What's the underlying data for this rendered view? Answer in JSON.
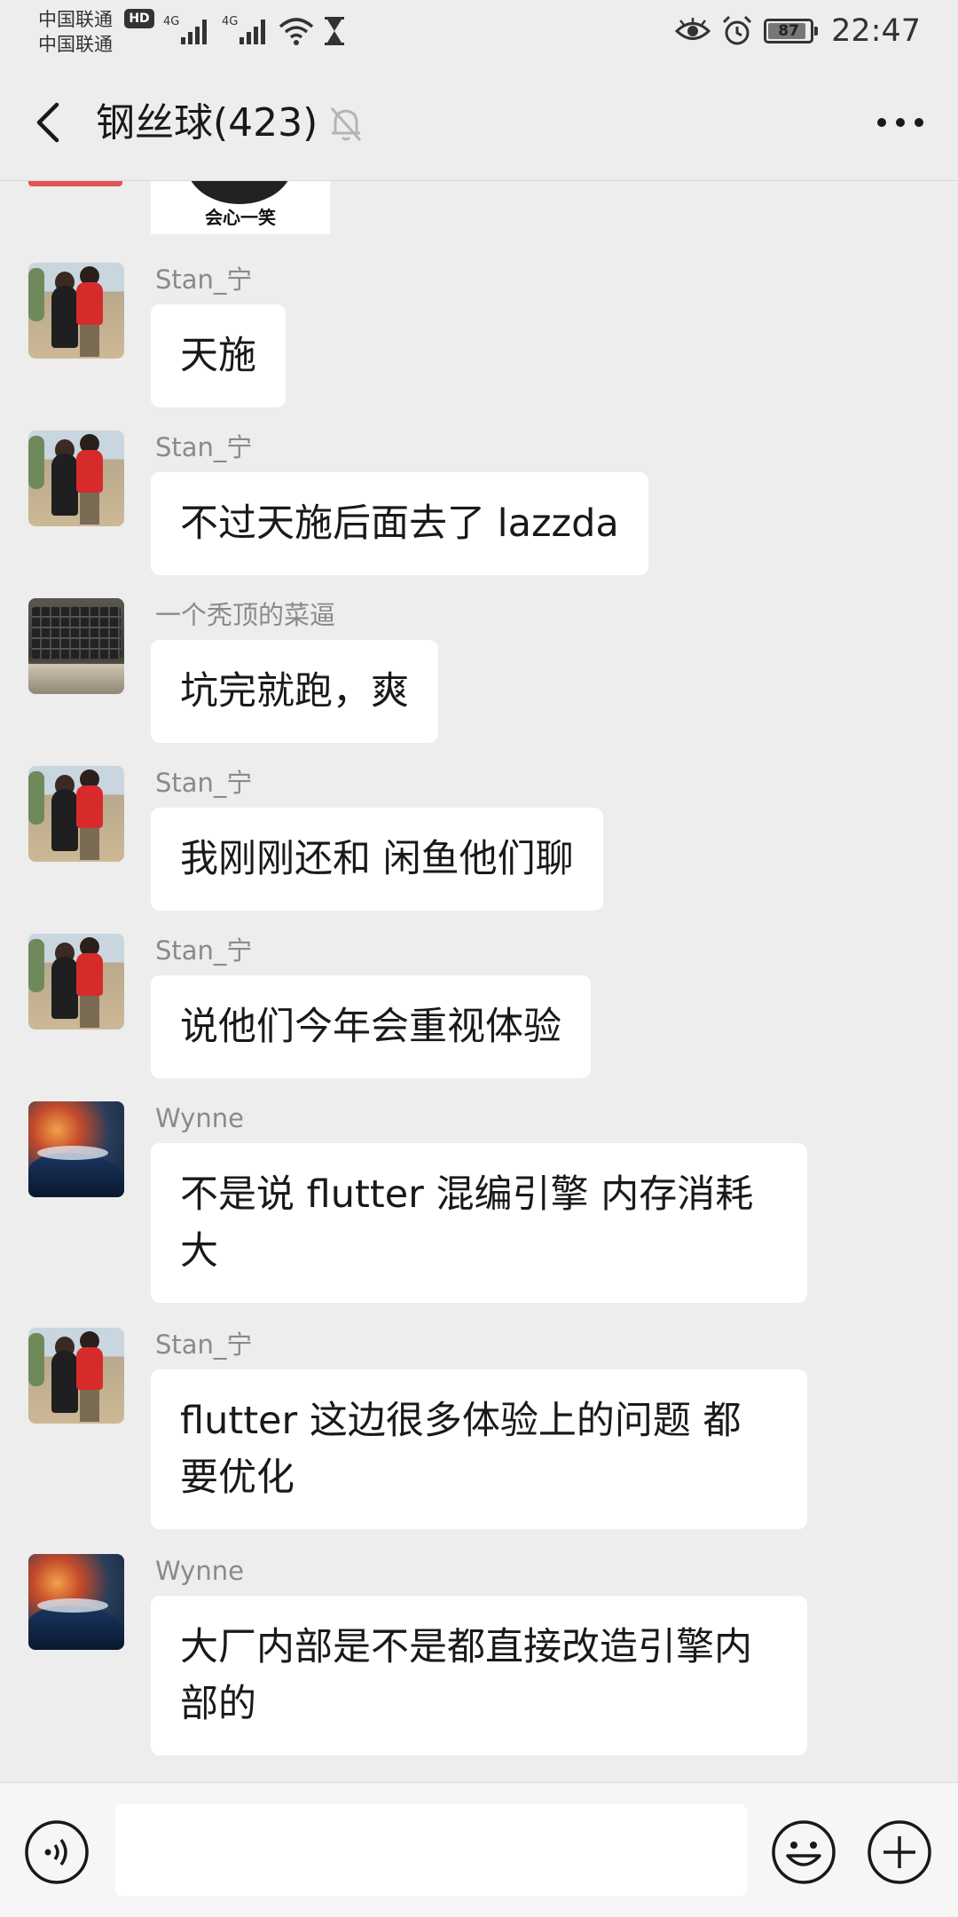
{
  "status_bar": {
    "carrier_1": "中国联通",
    "carrier_2": "中国联通",
    "hd_badge": "HD",
    "network_1": "4G",
    "network_2": "4G",
    "battery_level": "87",
    "time": "22:47",
    "icons": [
      "signal-icon",
      "wifi-icon",
      "hourglass-icon",
      "eye-icon",
      "alarm-icon",
      "battery-icon"
    ]
  },
  "nav": {
    "title": "钢丝球(423)",
    "icons": [
      "back-arrow-icon",
      "mute-bell-icon",
      "more-dots-icon"
    ]
  },
  "top_image": {
    "caption": "会心一笑"
  },
  "messages": [
    {
      "sender": "Stan_宁",
      "text": "天施"
    },
    {
      "sender": "Stan_宁",
      "text": "不过天施后面去了 lazzda"
    },
    {
      "sender": "一个秃顶的菜逼",
      "text": "坑完就跑，爽"
    },
    {
      "sender": "Stan_宁",
      "text": "我刚刚还和 闲鱼他们聊"
    },
    {
      "sender": "Stan_宁",
      "text": "说他们今年会重视体验"
    },
    {
      "sender": "Wynne",
      "text": "不是说 flutter 混编引擎 内存消耗大"
    },
    {
      "sender": "Stan_宁",
      "text": "flutter 这边很多体验上的问题 都要优化"
    },
    {
      "sender": "Wynne",
      "text": "大厂内部是不是都直接改造引擎内部的"
    }
  ],
  "input_bar": {
    "input_value": "",
    "icons": [
      "voice-icon",
      "emoji-icon",
      "plus-icon"
    ]
  },
  "colors": {
    "background": "#ededed",
    "bubble": "#ffffff",
    "sender_name": "#8a8a8a"
  }
}
